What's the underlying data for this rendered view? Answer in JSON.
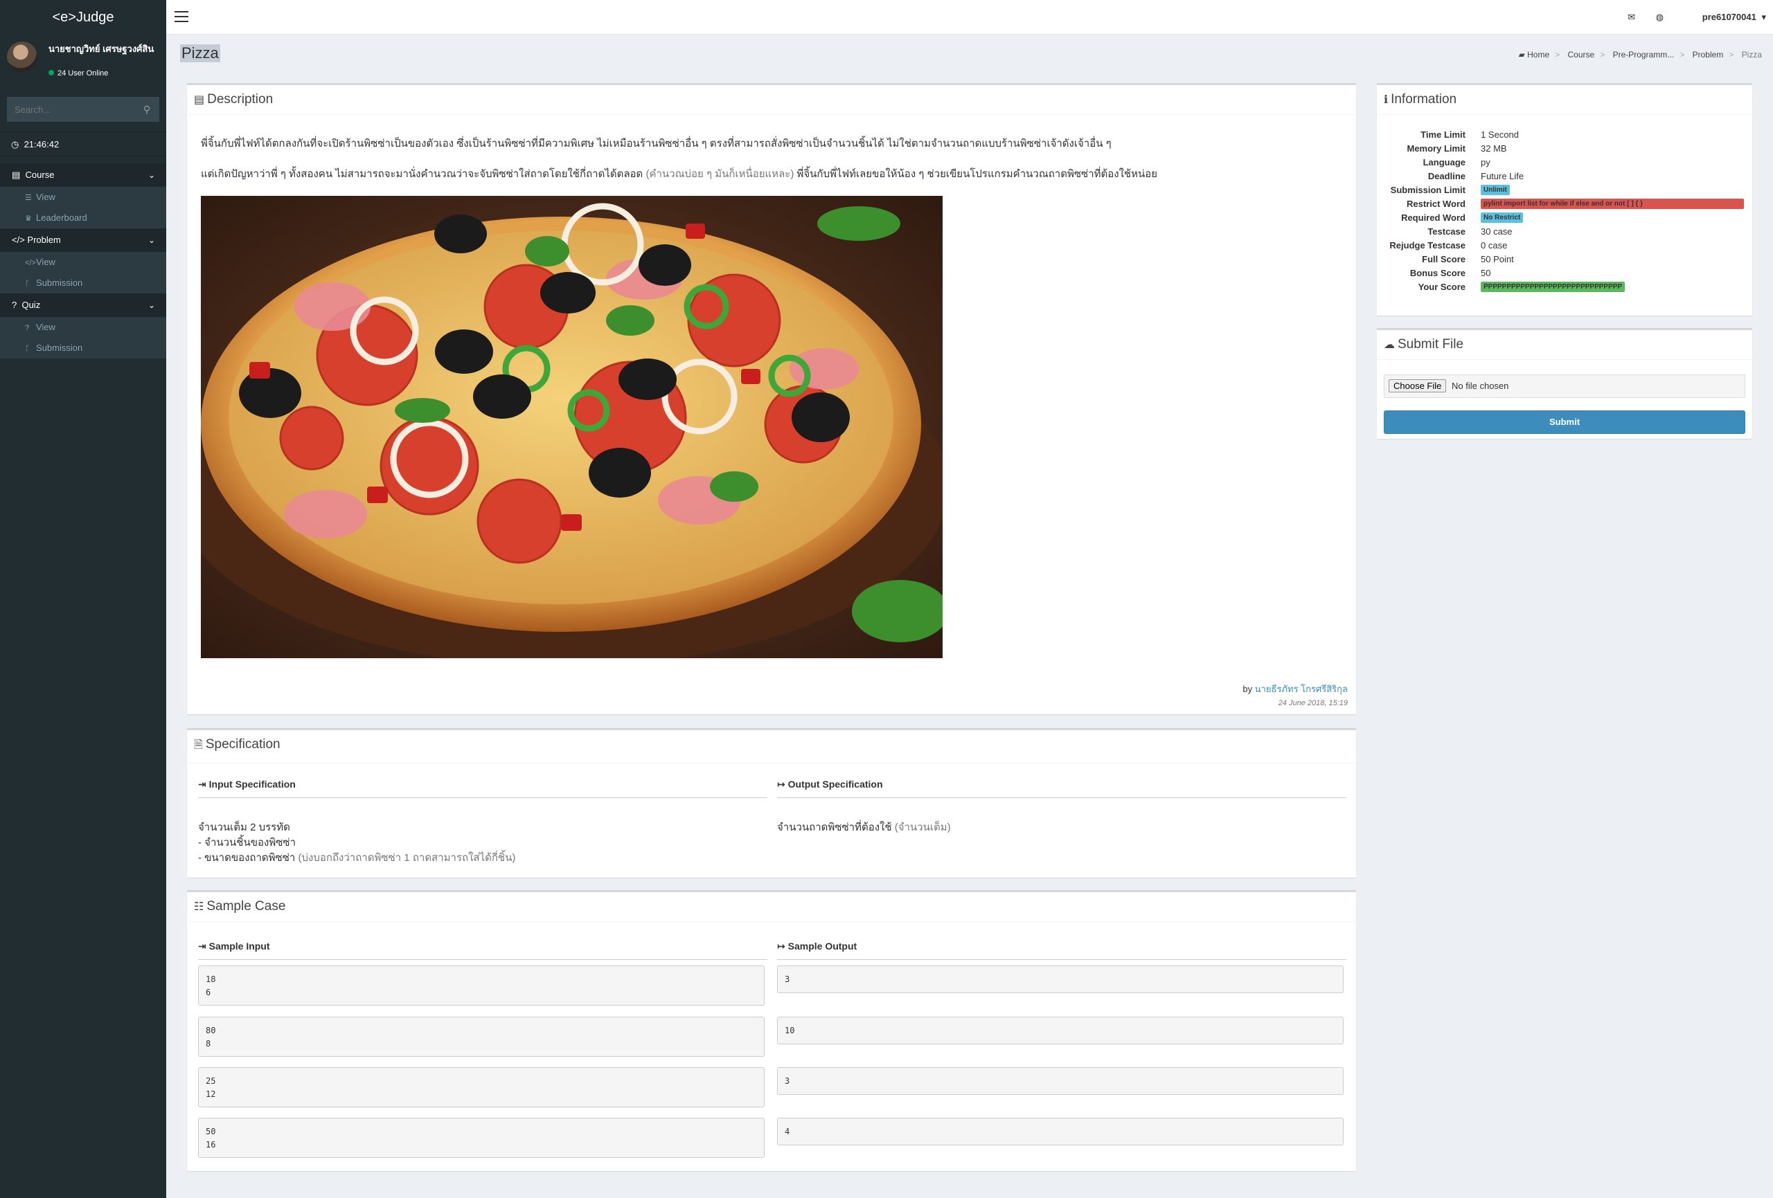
{
  "app": {
    "logo": "<e>Judge"
  },
  "user": {
    "name": "นายชาญวิทย์ เศรษฐวงศ์สิน",
    "online_text": "24 User Online"
  },
  "search": {
    "placeholder": "Search..."
  },
  "clock": "21:46:42",
  "menu": {
    "course": {
      "label": "Course",
      "items": [
        "View",
        "Leaderboard"
      ]
    },
    "problem": {
      "label": "Problem",
      "items": [
        "View",
        "Submission"
      ]
    },
    "quiz": {
      "label": "Quiz",
      "items": [
        "View",
        "Submission"
      ]
    }
  },
  "topbar": {
    "username": "pre61070041"
  },
  "page": {
    "title": "Pizza"
  },
  "breadcrumb": [
    "Home",
    "Course",
    "Pre-Programm...",
    "Problem",
    "Pizza"
  ],
  "description": {
    "title": "Description",
    "p1": "พี่จิ้นกับพี่ไฟท์ได้ตกลงกันที่จะเปิดร้านพิซซ่าเป็นของตัวเอง ซึ่งเป็นร้านพิซซ่าที่มีความพิเศษ ไม่เหมือนร้านพิซซ่าอื่น ๆ ตรงที่สามารถสั่งพิซซ่าเป็นจำนวนชิ้นได้ ไม่ใช่ตามจำนวนถาดแบบร้านพิซซ่าเจ้าดังเจ้าอื่น ๆ",
    "p2_a": "แต่เกิดปัญหาว่าพี่ ๆ ทั้งสองคน ไม่สามารถจะมานั่งคำนวณว่าจะจับพิซซ่าใส่ถาดโดยใช้กี่ถาดได้ตลอด",
    "p2_muted": "(คำนวณบ่อย ๆ มันก็เหนื่อยแหละ)",
    "p2_b": "พี่จิ้นกับพี่ไฟท์เลยขอให้น้อง ๆ ช่วยเขียนโปรแกรมคำนวณถาดพิซซ่าที่ต้องใช้หน่อย",
    "by_label": "by",
    "author": "นายธีรภัทร โกรศรีสิริกุล",
    "date": "24 June 2018, 15:19"
  },
  "specification": {
    "title": "Specification",
    "input_head": "Input Specification",
    "output_head": "Output Specification",
    "input_line1": "จำนวนเต็ม 2 บรรทัด",
    "input_line2": "- จำนวนชิ้นของพิซซ่า",
    "input_line3": "- ขนาดของถาดพิซซ่า",
    "input_line3_muted": "(บ่งบอกถึงว่าถาดพิซซ่า 1 ถาดสามารถใส่ได้กี่ชิ้น)",
    "output_line": "จำนวนถาดพิซซ่าที่ต้องใช้",
    "output_muted": "(จำนวนเต็ม)"
  },
  "sample": {
    "title": "Sample Case",
    "input_head": "Sample Input",
    "output_head": "Sample Output",
    "cases": [
      {
        "input": "18\n6",
        "output": "3"
      },
      {
        "input": "80\n8",
        "output": "10"
      },
      {
        "input": "25\n12",
        "output": "3"
      },
      {
        "input": "50\n16",
        "output": "4"
      }
    ]
  },
  "information": {
    "title": "Information",
    "rows": [
      {
        "k": "Time Limit",
        "v": "1 Second"
      },
      {
        "k": "Memory Limit",
        "v": "32 MB"
      },
      {
        "k": "Language",
        "v": "py"
      },
      {
        "k": "Deadline",
        "v": "Future Life"
      },
      {
        "k": "Submission Limit",
        "v": "Unlimit"
      },
      {
        "k": "Restrict Word",
        "v": "pylint import list for while if else and or not [ ] { }"
      },
      {
        "k": "Required Word",
        "v": "No Restrict"
      },
      {
        "k": "Testcase",
        "v": "30 case"
      },
      {
        "k": "Rejudge Testcase",
        "v": "0 case"
      },
      {
        "k": "Full Score",
        "v": "50 Point"
      },
      {
        "k": "Bonus Score",
        "v": "50"
      },
      {
        "k": "Your Score",
        "v": "PPPPPPPPPPPPPPPPPPPPPPPPPPPPPP"
      }
    ]
  },
  "submit_file": {
    "title": "Submit File",
    "choose_label": "Choose File",
    "no_file": "No file chosen",
    "submit_label": "Submit"
  },
  "colors": {
    "sidebar": "#222d32",
    "accent": "#3c8dbc",
    "badge_blue": "#5bc0de",
    "badge_red": "#d9534f",
    "badge_green": "#5cb85c"
  }
}
